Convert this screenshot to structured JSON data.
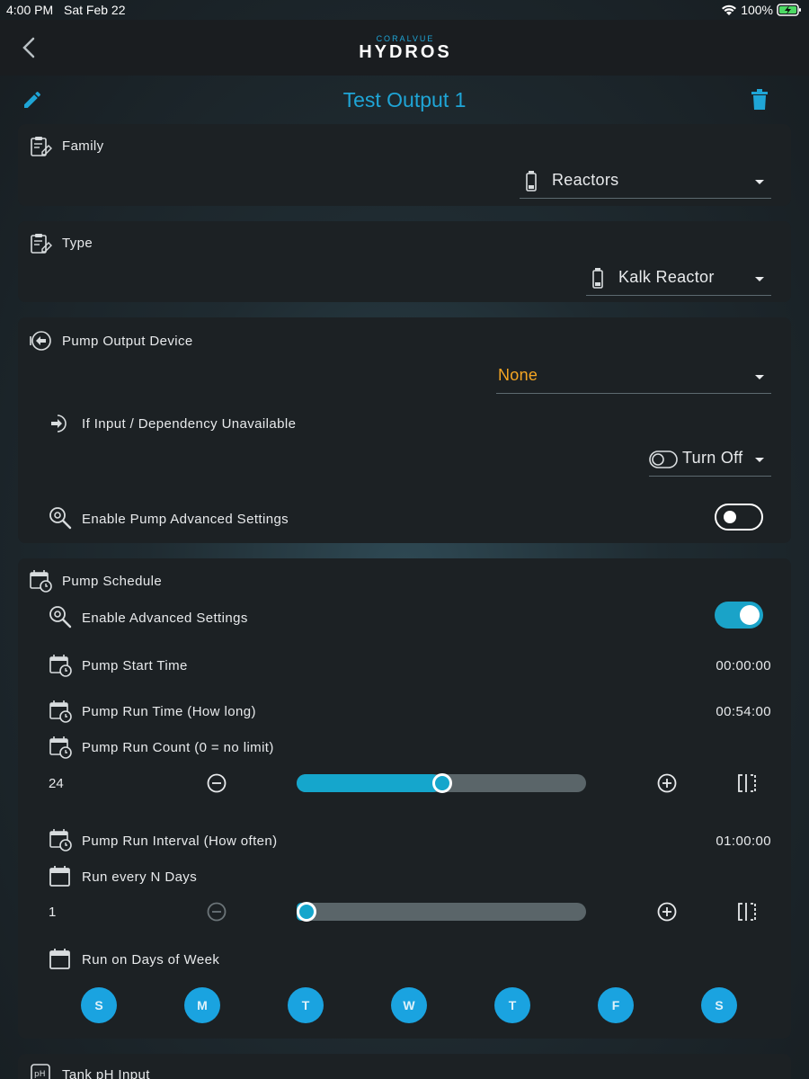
{
  "status": {
    "time": "4:00 PM",
    "date": "Sat Feb 22",
    "battery": "100%"
  },
  "logo": {
    "brand_small": "CORALVUE",
    "brand_big": "HYDROS"
  },
  "header": {
    "title": "Test Output 1"
  },
  "family": {
    "label": "Family",
    "value": "Reactors"
  },
  "type": {
    "label": "Type",
    "value": "Kalk Reactor"
  },
  "pump_output": {
    "label": "Pump Output Device",
    "device_value": "None",
    "unavailable_label": "If Input / Dependency Unavailable",
    "unavailable_value": "Turn Off",
    "advanced_label": "Enable Pump Advanced Settings",
    "advanced_enabled": false
  },
  "schedule": {
    "label": "Pump Schedule",
    "advanced_label": "Enable Advanced Settings",
    "advanced_enabled": true,
    "start_label": "Pump Start Time",
    "start_value": "00:00:00",
    "runtime_label": "Pump Run Time (How long)",
    "runtime_value": "00:54:00",
    "runcount_label": "Pump Run Count (0 = no limit)",
    "runcount_value": "24",
    "runcount_fraction": 0.5,
    "interval_label": "Pump Run Interval (How often)",
    "interval_value": "01:00:00",
    "ndays_label": "Run every N Days",
    "ndays_value": "1",
    "ndays_fraction": 0.03,
    "dow_label": "Run on Days of Week",
    "days": [
      "S",
      "M",
      "T",
      "W",
      "T",
      "F",
      "S"
    ]
  },
  "tank_ph": {
    "label": "Tank pH Input"
  },
  "colors": {
    "accent": "#1fa5d6",
    "warning": "#f5a623",
    "card": "#1c2124"
  }
}
